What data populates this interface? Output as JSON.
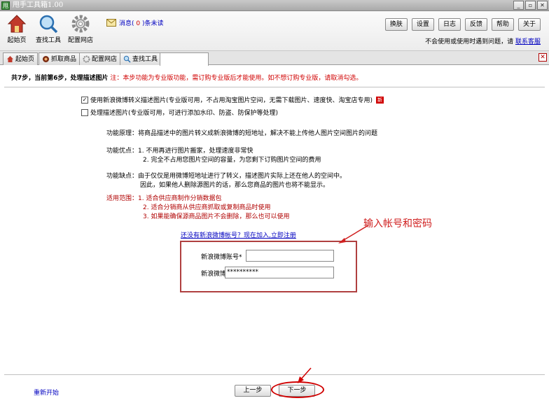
{
  "window": {
    "title": "甩手工具箱1.00",
    "app_icon_char": "甩",
    "controls": [
      "_",
      "▫",
      "✕"
    ]
  },
  "toolbar": {
    "home": "起始页",
    "find": "查找工具",
    "config": "配置网店",
    "message_prefix": "消息(",
    "message_count": "0",
    "message_suffix": ")条未读",
    "buttons": [
      "换肤",
      "设置",
      "日志",
      "反馈",
      "帮助",
      "关于"
    ],
    "help_text": "不会使用或使用时遇到问题，请",
    "help_link": "联系客服"
  },
  "tabs": [
    "起始页",
    "抓取商品",
    "配置网店",
    "查找工具",
    ""
  ],
  "step": {
    "title": "共7步，当前第6步，处理描述图片",
    "note": "注：本步功能为专业版功能，需订购专业版后才能使用。如不想订购专业版，请取消勾选。"
  },
  "options": {
    "opt1": "使用新浪微博转义描述图片(专业版可用，不占用淘宝图片空间，无需下载图片、速度快、淘宝店专用)",
    "opt1_checked": "✓",
    "opt1_badge": "新",
    "opt2": "处理描述图片(专业版可用，可进行添加水印、防盗、防保护等处理)"
  },
  "description": {
    "principle": "功能原理：将商品描述中的图片转义成新浪微博的短地址，解决不能上传他人图片空间图片的问题",
    "pros_1": "功能优点：1. 不用再进行图片搬家，处理速度非常快",
    "pros_2": "2. 完全不占用您图片空间的容量，为您剩下订购图片空间的费用",
    "cons_1": "功能缺点：由于仅仅是用微博短地址进行了转义，描述图片实际上还在他人的空间中。",
    "cons_2": "因此，如果他人删除源图片的话，那么您商品的图片也将不能显示。",
    "scope_1": "适用范围：1. 适合供应商制作分销数据包",
    "scope_2": "2. 适合分销商从供应商抓取或复制商品时使用",
    "scope_3": "3. 如果能确保源商品图片不会删除，那么也可以使用"
  },
  "login": {
    "register_link": "还没有新浪微博帐号？现在加入,立即注册",
    "account_label": "新浪微博账号*",
    "account_value": "",
    "password_label": "新浪微博密码*",
    "password_value": "**********"
  },
  "annotation": "输入帐号和密码",
  "nav": {
    "restart": "重新开始",
    "prev": "上一步",
    "next": "下一步"
  }
}
